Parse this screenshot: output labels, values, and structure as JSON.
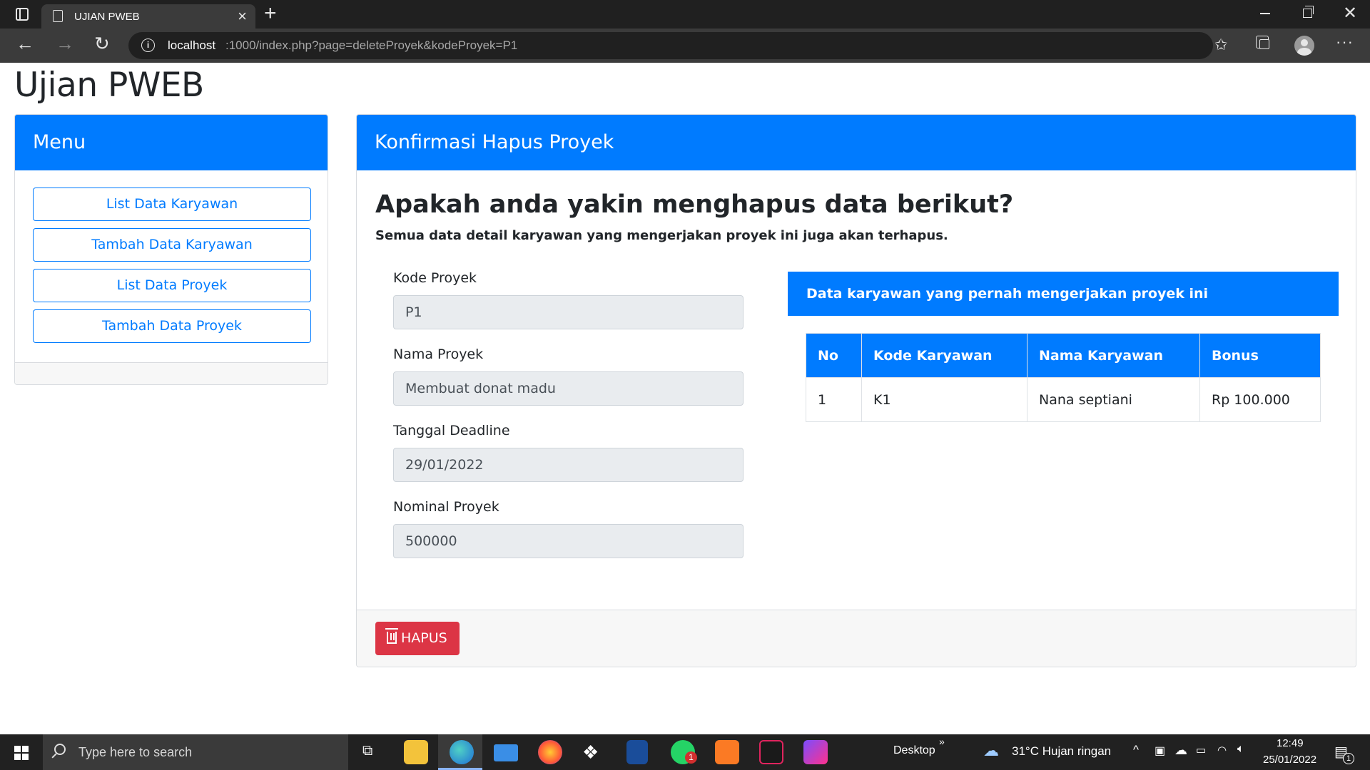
{
  "browser": {
    "tab_title": "UJIAN PWEB",
    "url_host": "localhost",
    "url_rest": ":1000/index.php?page=deleteProyek&kodeProyek=P1"
  },
  "page": {
    "title": "Ujian PWEB"
  },
  "menu": {
    "header": "Menu",
    "items": [
      {
        "label": "List Data Karyawan"
      },
      {
        "label": "Tambah Data Karyawan"
      },
      {
        "label": "List Data Proyek"
      },
      {
        "label": "Tambah Data Proyek"
      }
    ]
  },
  "confirm": {
    "header": "Konfirmasi Hapus Proyek",
    "question": "Apakah anda yakin menghapus data berikut?",
    "note": "Semua data detail karyawan yang mengerjakan proyek ini juga akan terhapus.",
    "fields": [
      {
        "label": "Kode Proyek",
        "value": "P1"
      },
      {
        "label": "Nama Proyek",
        "value": "Membuat donat madu"
      },
      {
        "label": "Tanggal Deadline",
        "value": "29/01/2022"
      },
      {
        "label": "Nominal Proyek",
        "value": "500000"
      }
    ],
    "employees": {
      "header": "Data karyawan yang pernah mengerjakan proyek ini",
      "columns": [
        "No",
        "Kode Karyawan",
        "Nama Karyawan",
        "Bonus"
      ],
      "rows": [
        [
          "1",
          "K1",
          "Nana septiani",
          "Rp 100.000"
        ]
      ]
    },
    "delete_button": "HAPUS",
    "delete_color": "#dc3545",
    "accent_color": "#007bff"
  },
  "taskbar": {
    "search_placeholder": "Type here to search",
    "desktop_label": "Desktop",
    "weather": "31°C  Hujan ringan",
    "time": "12:49",
    "date": "25/01/2022",
    "whatsapp_badge": "1",
    "notification_count": "1",
    "apps": [
      "task-view-icon",
      "file-explorer-icon",
      "edge-icon",
      "mail-icon",
      "firefox-icon",
      "dropbox-icon",
      "vscode-icon",
      "whatsapp-icon",
      "xampp-icon",
      "app-icon",
      "phpstorm-icon"
    ]
  }
}
